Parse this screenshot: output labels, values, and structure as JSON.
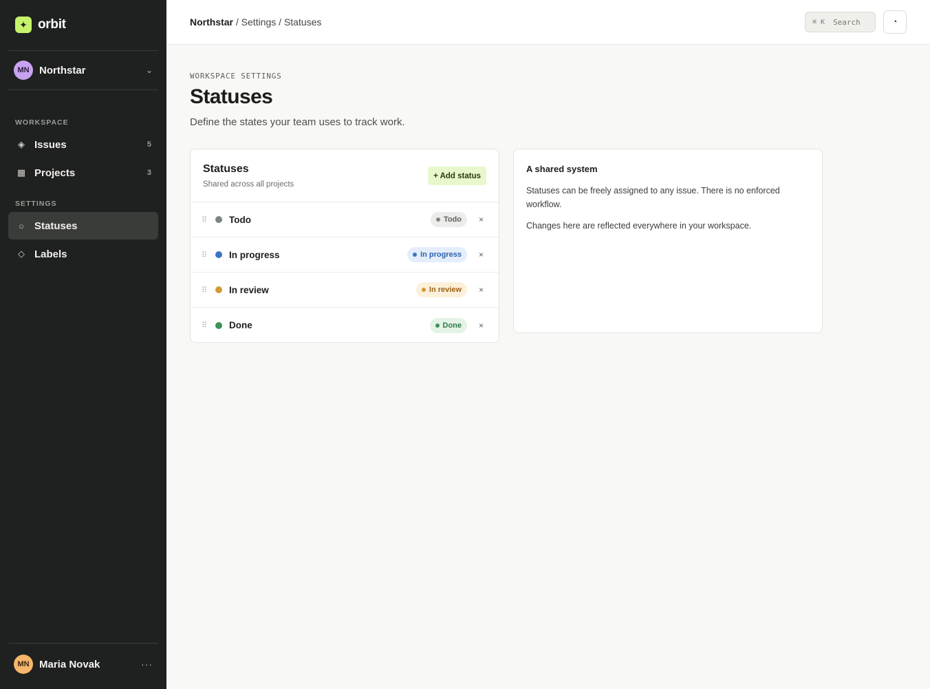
{
  "brand": {
    "name": "orbit",
    "logo_glyph": "✦",
    "accent": "#c6f36b"
  },
  "workspace_switcher": {
    "initials": "MN",
    "name": "Northstar",
    "chevron": "⌄"
  },
  "sidebar": {
    "workspace_label": "WORKSPACE",
    "workspace_items": [
      {
        "label": "Issues",
        "count": "5",
        "icon": "diamond-icon",
        "glyph": "◈"
      },
      {
        "label": "Projects",
        "count": "3",
        "icon": "grid-icon",
        "glyph": "▦"
      }
    ],
    "settings_label": "SETTINGS",
    "settings_items": [
      {
        "label": "Statuses",
        "icon": "circle-icon",
        "glyph": "○",
        "active": true
      },
      {
        "label": "Labels",
        "icon": "tag-diamond-icon",
        "glyph": "◇",
        "active": false
      }
    ]
  },
  "user": {
    "initials": "MN",
    "name": "Maria Novak",
    "more": "···"
  },
  "header": {
    "crumb_root": "Northstar",
    "crumb_rest": " / Settings / Statuses",
    "search_kbd": "⌘ K",
    "search_label": "Search",
    "clock_glyph": "◔"
  },
  "page": {
    "eyebrow": "WORKSPACE SETTINGS",
    "title": "Statuses",
    "description": "Define the states your team uses to track work."
  },
  "statuses_card": {
    "title": "Statuses",
    "subtitle": "Shared across all projects",
    "add_label": "+ Add status",
    "drag_glyph": "⠿",
    "remove_glyph": "×",
    "rows": [
      {
        "name": "Todo",
        "pill": "Todo",
        "color": "#7b8680",
        "pill_bg": "#ececea",
        "pill_fg": "#5e625f"
      },
      {
        "name": "In progress",
        "pill": "In progress",
        "color": "#3a74c4",
        "pill_bg": "#e4eefb",
        "pill_fg": "#2d62ad"
      },
      {
        "name": "In review",
        "pill": "In review",
        "color": "#d39a36",
        "pill_bg": "#fdf0da",
        "pill_fg": "#9a6415"
      },
      {
        "name": "Done",
        "pill": "Done",
        "color": "#3f9158",
        "pill_bg": "#e3f3e6",
        "pill_fg": "#2e7a45"
      }
    ]
  },
  "info_card": {
    "title": "A shared system",
    "p1": "Statuses can be freely assigned to any issue. There is no enforced workflow.",
    "p2": "Changes here are reflected everywhere in your workspace."
  }
}
